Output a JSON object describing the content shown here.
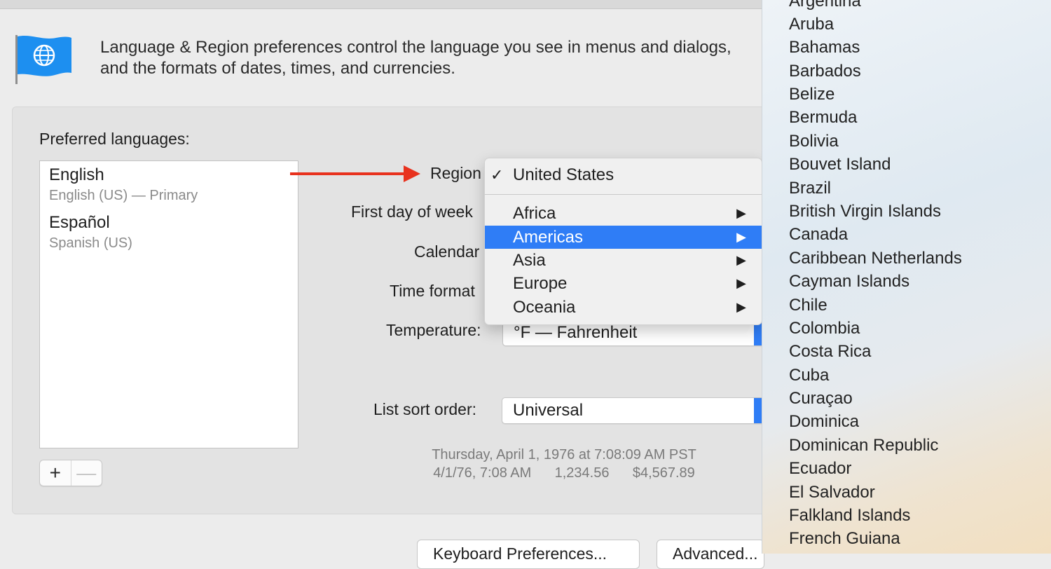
{
  "intro": {
    "line1": "Language & Region preferences control the language you see in menus and dialogs,",
    "line2": "and the formats of dates, times, and currencies."
  },
  "icons": {
    "flag": "globe-flag-icon",
    "arrow": "red-arrow-annotation",
    "check": "checkmark-icon",
    "submenu": "submenu-triangle-icon"
  },
  "languages": {
    "label": "Preferred languages:",
    "items": [
      {
        "name": "English",
        "sub": "English (US) — Primary"
      },
      {
        "name": "Español",
        "sub": "Spanish (US)"
      }
    ],
    "add": "+",
    "remove": "—"
  },
  "form": {
    "region_label": "Region",
    "first_day_label": "First day of week",
    "calendar_label": "Calendar",
    "time_format_label": "Time format",
    "temperature_label": "Temperature:",
    "temperature_value": "°F — Fahrenheit",
    "sort_label": "List sort order:",
    "sort_value": "Universal"
  },
  "sample": {
    "line1": "Thursday, April 1, 1976 at 7:08:09 AM PST",
    "line2": "4/1/76, 7:08 AM      1,234.56      $4,567.89"
  },
  "buttons": {
    "keyboard": "Keyboard Preferences...",
    "advanced": "Advanced..."
  },
  "region_menu": {
    "selected": "United States",
    "check": "✓",
    "arrow": "▶",
    "items": [
      "Africa",
      "Americas",
      "Asia",
      "Europe",
      "Oceania"
    ],
    "highlighted": "Americas"
  },
  "countries": [
    "Argentina",
    "Aruba",
    "Bahamas",
    "Barbados",
    "Belize",
    "Bermuda",
    "Bolivia",
    "Bouvet Island",
    "Brazil",
    "British Virgin Islands",
    "Canada",
    "Caribbean Netherlands",
    "Cayman Islands",
    "Chile",
    "Colombia",
    "Costa Rica",
    "Cuba",
    "Curaçao",
    "Dominica",
    "Dominican Republic",
    "Ecuador",
    "El Salvador",
    "Falkland Islands",
    "French Guiana"
  ],
  "colors": {
    "accent": "#2f7df6",
    "arrow": "#e8321e"
  }
}
